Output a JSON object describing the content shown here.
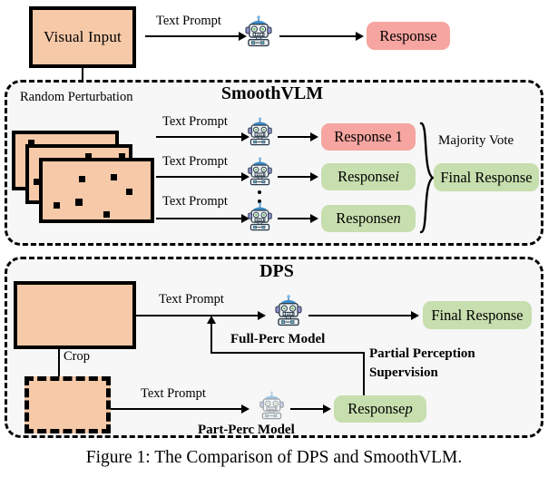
{
  "figure": {
    "caption": "Figure 1: The Comparison of DPS and SmoothVLM."
  },
  "colors": {
    "image_fill": "#F6C9A8",
    "response_red": "#F6A5A0",
    "response_green": "#C7DEAE",
    "panel_fill": "#F7F7F7",
    "stroke": "#000000"
  },
  "top_flow": {
    "visual_input_label": "Visual Input",
    "text_prompt_label": "Text Prompt",
    "model_icon": "robot-icon",
    "response_label": "Response"
  },
  "smoothvlm": {
    "title": "SmoothVLM",
    "perturbation_label": "Random Perturbation",
    "rows": [
      {
        "text_prompt_label": "Text Prompt",
        "model_icon": "robot-icon",
        "response_label": "Response 1",
        "response_style": "red"
      },
      {
        "text_prompt_label": "Text Prompt",
        "model_icon": "robot-icon",
        "response_label": "Response i",
        "response_style": "green"
      },
      {
        "text_prompt_label": "Text Prompt",
        "model_icon": "robot-icon",
        "response_label": "Response n",
        "response_style": "green"
      }
    ],
    "responses": {
      "first": "Response 1",
      "middle_prefix": "Response ",
      "middle_suffix": "i",
      "last_prefix": "Response ",
      "last_suffix": "n"
    },
    "aggregation_label": "Majority Vote",
    "final_response_label": "Final Response",
    "ellipsis": "vertical-ellipsis"
  },
  "dps": {
    "title": "DPS",
    "text_prompt_full_label": "Text Prompt",
    "full_model_label": "Full-Perc Model",
    "full_model_icon": "robot-icon",
    "final_response_label": "Final Response",
    "crop_label": "Crop",
    "text_prompt_part_label": "Text Prompt",
    "part_model_label": "Part-Perc Model",
    "part_model_icon": "robot-icon-faded",
    "response_p_prefix": "Response ",
    "response_p_suffix": "p",
    "supervision_label_line1": "Partial Perception",
    "supervision_label_line2": "Supervision"
  }
}
